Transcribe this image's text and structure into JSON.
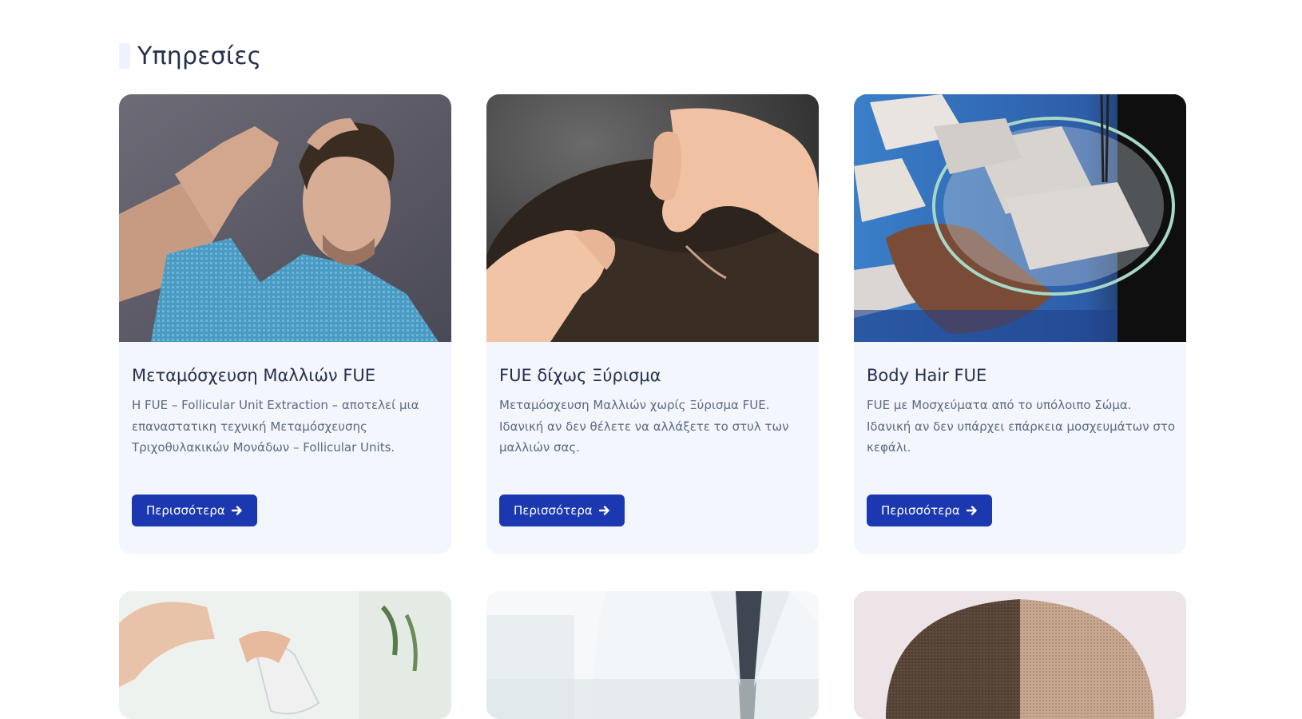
{
  "section": {
    "title": "Υπηρεσίες"
  },
  "cards": [
    {
      "title": "Μεταμόσχευση Μαλλιών FUE",
      "description": "Η FUE – Follicular Unit Extraction – αποτελεί μια επαναστατικη τεχνική Μεταμόσχευσης Τριχοθυλακικών Μονάδων – Follicular Units.",
      "button": "Περισσότερα",
      "image": "man-touching-hair-photo"
    },
    {
      "title": "FUE δίχως Ξύρισμα",
      "description": "Μεταμόσχευση Μαλλιών χωρίς Ξύρισμα FUE. Ιδανική αν δεν θέλετε να αλλάξετε το στυλ των μαλλιών σας.",
      "button": "Περισσότερα",
      "image": "hands-parting-hair-photo"
    },
    {
      "title": "Body Hair FUE",
      "description": "FUE με Μοσχεύματα από το υπόλοιπο Σώμα. Ιδανική αν δεν υπάρχει επάρκεια μοσχευμάτων στο κεφάλι.",
      "button": "Περισσότερα",
      "image": "grafts-petri-dish-photo"
    }
  ],
  "row2_images": [
    "hair-device-photo",
    "doctor-photo",
    "shaved-head-photo"
  ],
  "colors": {
    "button": "#1b38b0",
    "card_bg": "#f3f7fd",
    "title": "#25304d",
    "text": "#5c6882"
  }
}
